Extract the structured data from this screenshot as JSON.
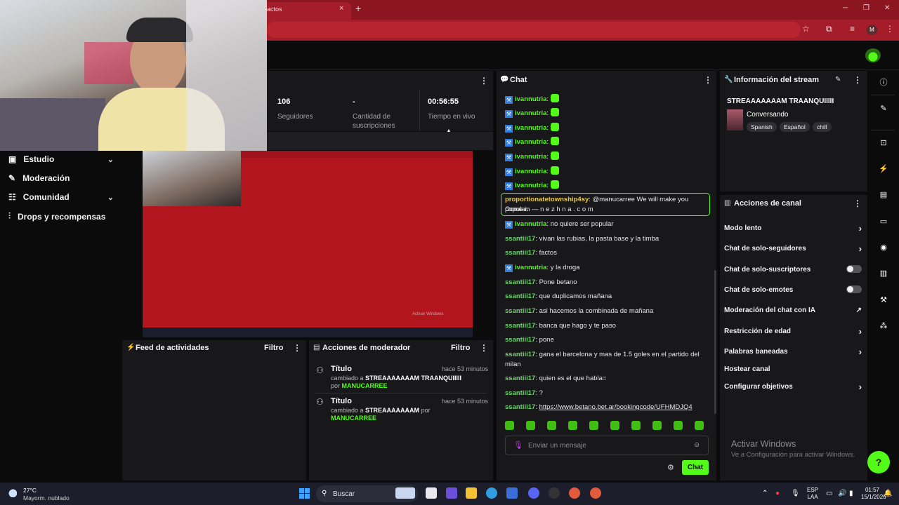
{
  "browser": {
    "tab_title": "actos",
    "tab_close": "×",
    "new_tab": "+",
    "profile_initial": "M",
    "window_controls": [
      "─",
      "❐",
      "✕"
    ]
  },
  "nav": {
    "items": [
      {
        "label": "Estudio",
        "icon": "studio-icon",
        "has_chevron": true
      },
      {
        "label": "Moderación",
        "icon": "wrench-icon",
        "has_chevron": false
      },
      {
        "label": "Comunidad",
        "icon": "users-icon",
        "has_chevron": true
      },
      {
        "label": "Drops y recompensas",
        "icon": "drops-icon",
        "has_chevron": false
      }
    ]
  },
  "stats": {
    "followers_value": "106",
    "followers_label": "Seguidores",
    "subs_value": "-",
    "subs_label_1": "Cantidad de",
    "subs_label_2": "suscripciones",
    "live_value": "00:56:55",
    "live_label": "Tiempo en vivo"
  },
  "preview": {
    "watermark": "Activar Windows"
  },
  "activity_feed": {
    "title": "Feed de actividades",
    "filter": "Filtro"
  },
  "mod_actions": {
    "title": "Acciones de moderador",
    "filter": "Filtro",
    "entries": [
      {
        "title": "Título",
        "time": "hace 53 minutos",
        "prefix": "cambiado a",
        "value": "STREAAAAAAAM TRAANQUIIIII",
        "by": "por",
        "user": "MANUCARREE"
      },
      {
        "title": "Título",
        "time": "hace 53 minutos",
        "prefix": "cambiado a",
        "value": "STREAAAAAAAM",
        "by": "por",
        "user": "MANUCARREE"
      }
    ]
  },
  "chat": {
    "title": "Chat",
    "messages": [
      {
        "user": "ivannutria",
        "mod": true,
        "text": "",
        "emote": true
      },
      {
        "user": "ivannutria",
        "mod": true,
        "text": "",
        "emote": true
      },
      {
        "user": "ivannutria",
        "mod": true,
        "text": "",
        "emote": true
      },
      {
        "user": "ivannutria",
        "mod": true,
        "text": "",
        "emote": true
      },
      {
        "user": "ivannutria",
        "mod": true,
        "text": "",
        "emote": true
      },
      {
        "user": "ivannutria",
        "mod": true,
        "text": "",
        "emote": true
      },
      {
        "user": "ivannutria",
        "mod": true,
        "text": "",
        "emote": true
      }
    ],
    "highlight_user": "proportionatetownship4sy",
    "highlight_text_1": "@manucarree We will make you popular.",
    "highlight_text_2": "Come in — n e z h n a . c o m",
    "lines": [
      {
        "user": "ivannutria",
        "mod": true,
        "text": "no quiere ser popular"
      },
      {
        "user": "ssantiii17",
        "mod": false,
        "text": "vivan las rubias, la pasta base y la timba"
      },
      {
        "user": "ssantiii17",
        "mod": false,
        "text": "factos"
      },
      {
        "user": "ivannutria",
        "mod": true,
        "text": "y la droga"
      },
      {
        "user": "ssantiii17",
        "mod": false,
        "text": "Pone betano"
      },
      {
        "user": "ssantiii17",
        "mod": false,
        "text": "que duplicamos mañana"
      },
      {
        "user": "ssantiii17",
        "mod": false,
        "text": "asi hacemos la combinada de mañana"
      },
      {
        "user": "ssantiii17",
        "mod": false,
        "text": "banca que hago y te paso"
      },
      {
        "user": "ssantiii17",
        "mod": false,
        "text": "pone"
      }
    ],
    "long_user": "ssantiii17",
    "long_text_1": "gana el barcelona y mas de 1.5 goles en el partido del",
    "long_text_2": "milan",
    "tail_lines": [
      {
        "user": "ssantiii17",
        "text": "quien es el que habla="
      },
      {
        "user": "ssantiii17",
        "text": "?"
      }
    ],
    "link_user": "ssantiii17",
    "link_text": "https://www.betano.bet.ar/bookingcode/UFHMDJQ4",
    "input_placeholder": "Enviar un mensaje",
    "send_label": "Chat"
  },
  "stream_info": {
    "title": "Información del stream",
    "stream_title": "STREAAAAAAAM TRAANQUIIIII",
    "category": "Conversando",
    "tags": [
      "Spanish",
      "Español",
      "chill"
    ]
  },
  "channel_actions": {
    "title": "Acciones de canal",
    "items": [
      {
        "label": "Modo lento",
        "control": "chevron"
      },
      {
        "label": "Chat de solo-seguidores",
        "control": "chevron"
      },
      {
        "label": "Chat de solo-suscriptores",
        "control": "toggle",
        "on": false
      },
      {
        "label": "Chat de solo-emotes",
        "control": "toggle",
        "on": false
      },
      {
        "label": "Moderación del chat con IA",
        "control": "external"
      },
      {
        "label": "Restricción de edad",
        "control": "chevron"
      },
      {
        "label": "Palabras baneadas",
        "control": "chevron"
      },
      {
        "label": "Hostear canal",
        "control": "none"
      },
      {
        "label": "Configurar objetivos",
        "control": "chevron"
      }
    ]
  },
  "windows_activation": {
    "title": "Activar Windows",
    "subtitle": "Ve a Configuración para activar Windows."
  },
  "taskbar": {
    "temperature": "27°C",
    "weather": "Mayorm. nublado",
    "search": "Buscar",
    "lang_1": "ESP",
    "lang_2": "LAA",
    "time": "01:57",
    "date": "15/1/2026"
  },
  "colors": {
    "accent": "#53fc18",
    "browser_red": "#a51d2a",
    "panel": "#18181b"
  }
}
